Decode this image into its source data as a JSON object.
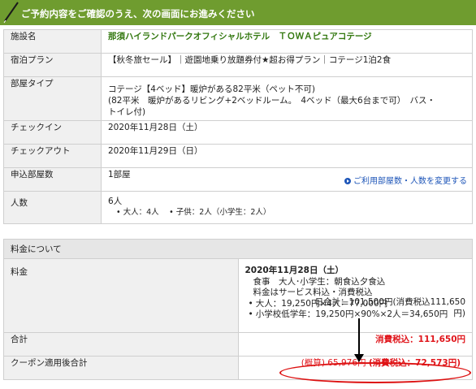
{
  "header": {
    "title": "ご予約内容をご確認のうえ、次の画面にお進みください"
  },
  "reservation": {
    "facility": {
      "label": "施設名",
      "value": "那須ハイランドパークオフィシャルホテル　ＴＯＷＡピュアコテージ"
    },
    "plan": {
      "label": "宿泊プラン",
      "value": "【秋冬旅セール】｜遊園地乗り放題券付★超お得プラン｜コテージ1泊2食"
    },
    "room": {
      "label": "部屋タイプ",
      "line1": "コテージ【4ベッド】暖炉がある82平米（ペット不可)",
      "line2": "(82平米　暖炉があるリビング+2ベッドルーム。　4ベッド（最大6台まで可）　バス・",
      "line3": "トイレ付)"
    },
    "checkin": {
      "label": "チェックイン",
      "value": "2020年11月28日（土）"
    },
    "checkout": {
      "label": "チェックアウト",
      "value": "2020年11月29日（日）"
    },
    "rooms": {
      "label": "申込部屋数",
      "value": "1部屋",
      "change_link": "ご利用部屋数・人数を変更する"
    },
    "people": {
      "label": "人数",
      "total": "6人",
      "breakdown": "大人：4人　 • 子供：2人（小学生：2人）"
    }
  },
  "pricing": {
    "section_title": "料金について",
    "fee": {
      "label": "料金",
      "date": "2020年11月28日（土）",
      "meal": "食事　大人･小学生：朝食込夕食込",
      "service": "料金はサービス料込・消費税込",
      "adult_line": "大人：19,250円×4人＝77,000円",
      "child_line": "小学校低学年：19,250円×90%×2人＝34,650円",
      "day_total_1": "日合計：101,500円(消費税込111,650",
      "day_total_2": "円)"
    },
    "total": {
      "label": "合計",
      "value": "消費税込：111,650円"
    },
    "coupon": {
      "label": "クーポン適用後合計",
      "value_prefix": "(概算) 65,976円",
      "value_tax": "(消費税込：72,573円)"
    }
  },
  "colors": {
    "header": "#6f9c2f",
    "accent_green": "#33780f",
    "highlight_red": "#e0151b",
    "link_blue": "#1d55b8"
  }
}
